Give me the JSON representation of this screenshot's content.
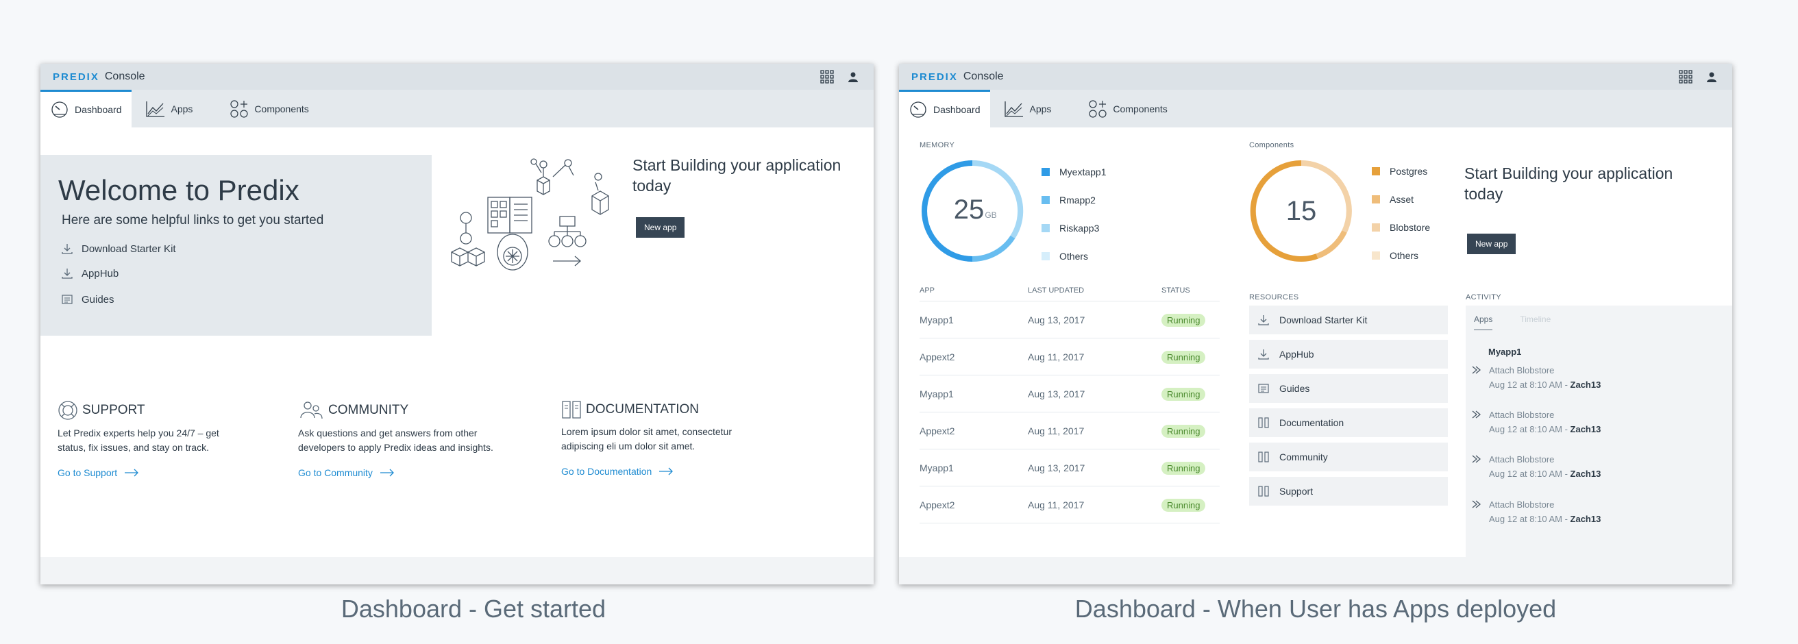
{
  "app": {
    "brand": "PREDIX",
    "title": "Console"
  },
  "tabs": [
    {
      "label": "Dashboard"
    },
    {
      "label": "Apps"
    },
    {
      "label": "Components"
    }
  ],
  "left": {
    "welcome_title": "Welcome to Predix",
    "welcome_sub": "Here are some helpful links to get you started",
    "links": [
      "Download Starter Kit",
      "AppHub",
      "Guides"
    ],
    "start_title": "Start Building your application today",
    "new_app_label": "New app",
    "columns": [
      {
        "title": "SUPPORT",
        "desc": "Let Predix experts help you 24/7 – get status, fix issues, and stay on track.",
        "link": "Go to Support",
        "icon": "support-icon"
      },
      {
        "title": "COMMUNITY",
        "desc": "Ask questions and get answers from other developers to apply Predix ideas and insights.",
        "link": "Go to Community",
        "icon": "community-icon"
      },
      {
        "title": "DOCUMENTATION",
        "desc": "Lorem ipsum dolor sit amet, consectetur adipiscing eli um dolor sit amet.",
        "link": "Go to Documentation",
        "icon": "documentation-icon"
      }
    ]
  },
  "right": {
    "memory": {
      "label": "MEMORY",
      "value": "25",
      "unit": "GB",
      "legend": [
        {
          "name": "Myextapp1",
          "color": "#2f9be6"
        },
        {
          "name": "Rmapp2",
          "color": "#68bdf0"
        },
        {
          "name": "Riskapp3",
          "color": "#a5d8f5"
        },
        {
          "name": "Others",
          "color": "#d6eefb"
        }
      ]
    },
    "components": {
      "label": "Components",
      "value": "15",
      "legend": [
        {
          "name": "Postgres",
          "color": "#e6a03a"
        },
        {
          "name": "Asset",
          "color": "#efbd7a"
        },
        {
          "name": "Blobstore",
          "color": "#f3d2a8"
        },
        {
          "name": "Others",
          "color": "#f8e6cc"
        }
      ]
    },
    "start_title": "Start Building your application today",
    "new_app_label": "New app",
    "table": {
      "headers": [
        "APP",
        "LAST UPDATED",
        "STATUS"
      ],
      "rows": [
        {
          "app": "Myapp1",
          "date": "Aug 13, 2017",
          "status": "Running"
        },
        {
          "app": "Appext2",
          "date": "Aug 11, 2017",
          "status": "Running"
        },
        {
          "app": "Myapp1",
          "date": "Aug 13, 2017",
          "status": "Running"
        },
        {
          "app": "Appext2",
          "date": "Aug 11, 2017",
          "status": "Running"
        },
        {
          "app": "Myapp1",
          "date": "Aug 13, 2017",
          "status": "Running"
        },
        {
          "app": "Appext2",
          "date": "Aug 11, 2017",
          "status": "Running"
        }
      ]
    },
    "resources": {
      "label": "RESOURCES",
      "items": [
        {
          "label": "Download Starter Kit",
          "icon": "download-icon"
        },
        {
          "label": "AppHub",
          "icon": "download-icon"
        },
        {
          "label": "Guides",
          "icon": "guides-icon"
        },
        {
          "label": "Documentation",
          "icon": "documentation-icon"
        },
        {
          "label": "Community",
          "icon": "community-icon"
        },
        {
          "label": "Support",
          "icon": "support-icon"
        }
      ]
    },
    "activity": {
      "label": "ACTIVITY",
      "tabs": [
        "Apps",
        "Timeline"
      ],
      "app": "Myapp1",
      "entries": [
        {
          "action": "Attach Blobstore",
          "time": "Aug 12 at 8:10 AM -",
          "user": "Zach13"
        },
        {
          "action": "Attach Blobstore",
          "time": "Aug 12 at 8:10 AM -",
          "user": "Zach13"
        },
        {
          "action": "Attach Blobstore",
          "time": "Aug 12 at 8:10 AM -",
          "user": "Zach13"
        },
        {
          "action": "Attach Blobstore",
          "time": "Aug 12 at 8:10 AM -",
          "user": "Zach13"
        }
      ]
    }
  },
  "captions": {
    "left": "Dashboard - Get started",
    "right": "Dashboard - When User has Apps deployed"
  }
}
